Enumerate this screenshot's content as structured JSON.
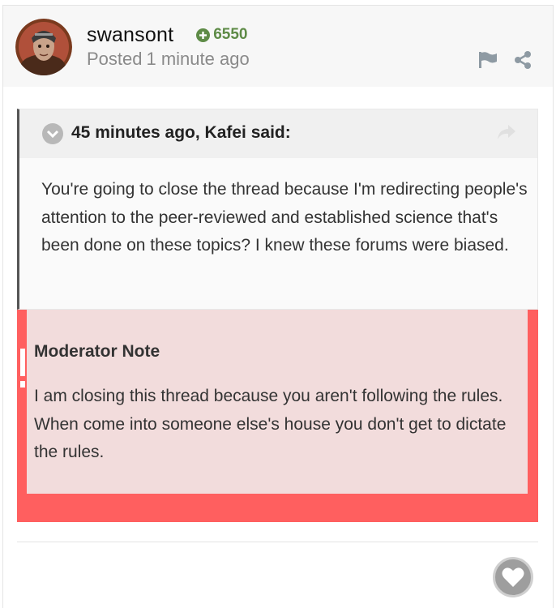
{
  "post": {
    "author": "swansont",
    "reputation": "6550",
    "posted_prefix": "Posted",
    "posted_time": "1 minute ago",
    "icons": {
      "reputation": "plus-circle-icon",
      "report": "flag-icon",
      "share": "share-icon"
    }
  },
  "quote": {
    "citation": "45 minutes ago, Kafei said:",
    "body": "You're going to close the thread because I'm redirecting people's attention to the peer-reviewed and established science that's been done on these topics? I knew these forums were biased.",
    "icons": {
      "toggle": "chevron-down-circle-icon",
      "goto": "arrow-share-icon"
    }
  },
  "moderator_note": {
    "title": "Moderator Note",
    "body": "I am closing this thread because you aren't following the rules. When come into someone else's house you don't get to dictate the rules.",
    "icon": "exclamation-icon"
  },
  "reactions": {
    "icon": "heart-icon"
  },
  "colors": {
    "reputation_green": "#5e8b47",
    "moderator_border": "#ff5f5f",
    "moderator_background": "#f2dcdc",
    "quote_border": "#555555"
  }
}
